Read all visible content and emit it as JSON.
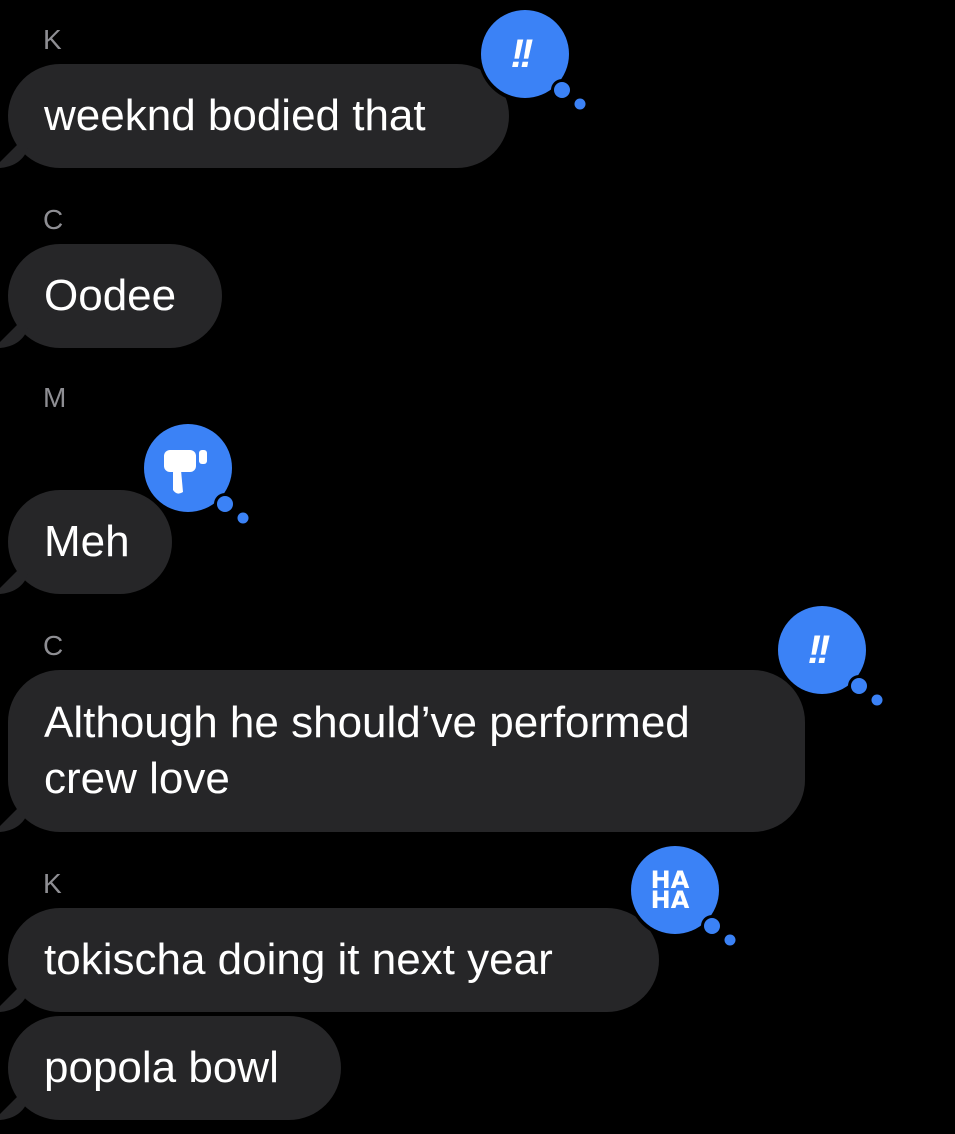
{
  "colors": {
    "background": "#000000",
    "bubble": "#262628",
    "sender_text": "#8e8e93",
    "message_text": "#ffffff",
    "tapback_blue": "#3b82f6"
  },
  "messages": [
    {
      "sender": "K",
      "text": "weeknd bodied that",
      "tapback": "exclamation-icon",
      "tapback_glyph": "!!"
    },
    {
      "sender": "C",
      "text": "Oodee",
      "tapback": null
    },
    {
      "sender": "M",
      "text": "Meh",
      "tapback": "thumbs-down-icon"
    },
    {
      "sender": "C",
      "text_lines": [
        "Although he should’ve performed",
        "crew love"
      ],
      "tapback": "exclamation-icon",
      "tapback_glyph": "!!"
    },
    {
      "sender": "K",
      "text": "tokischa doing it next year",
      "tapback": "haha-icon",
      "tapback_glyph_lines": [
        "HA",
        "HA"
      ]
    },
    {
      "sender": "",
      "text": "popola bowl",
      "tapback": null
    }
  ]
}
